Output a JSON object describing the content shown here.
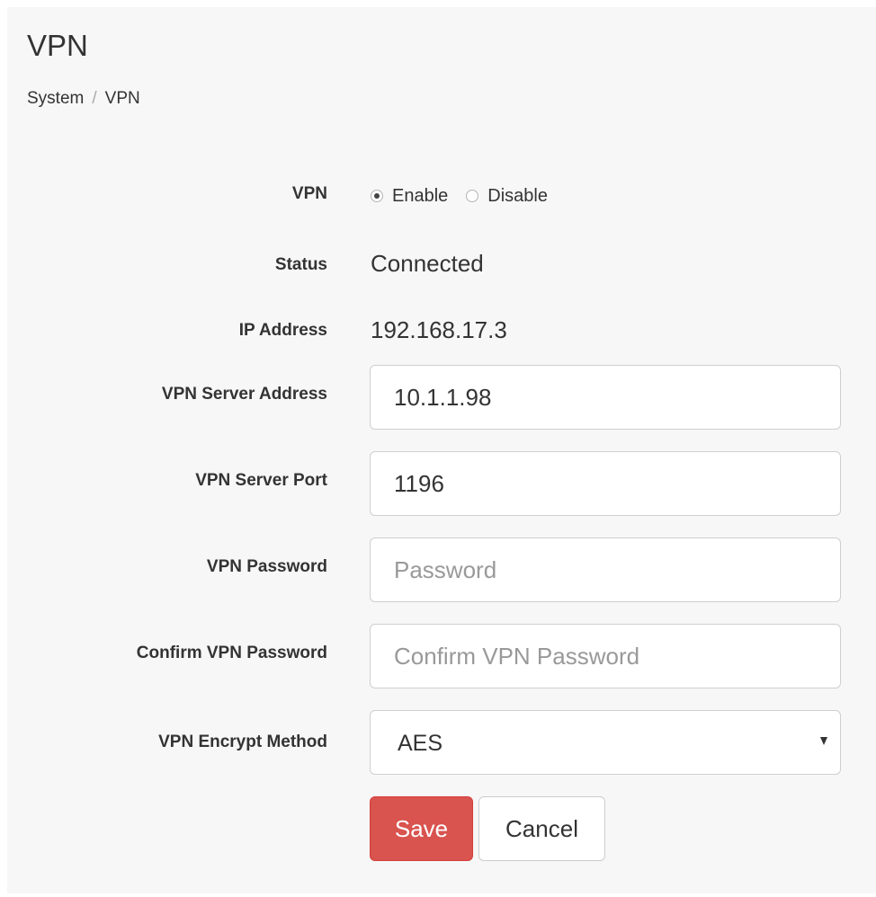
{
  "page": {
    "title": "VPN",
    "breadcrumb": [
      "System",
      "VPN"
    ],
    "breadcrumb_separator": "/"
  },
  "form": {
    "vpn": {
      "label": "VPN",
      "options": [
        {
          "label": "Enable",
          "selected": true
        },
        {
          "label": "Disable",
          "selected": false
        }
      ]
    },
    "status": {
      "label": "Status",
      "value": "Connected"
    },
    "ip_address": {
      "label": "IP Address",
      "value": "192.168.17.3"
    },
    "server_address": {
      "label": "VPN Server Address",
      "value": "10.1.1.98"
    },
    "server_port": {
      "label": "VPN Server Port",
      "value": "1196"
    },
    "password": {
      "label": "VPN Password",
      "value": "",
      "placeholder": "Password"
    },
    "confirm_password": {
      "label": "Confirm VPN Password",
      "value": "",
      "placeholder": "Confirm VPN Password"
    },
    "encrypt_method": {
      "label": "VPN Encrypt Method",
      "value": "AES"
    }
  },
  "actions": {
    "save_label": "Save",
    "cancel_label": "Cancel"
  },
  "colors": {
    "save_button": "#d9534f",
    "panel_background": "#f7f7f7"
  }
}
